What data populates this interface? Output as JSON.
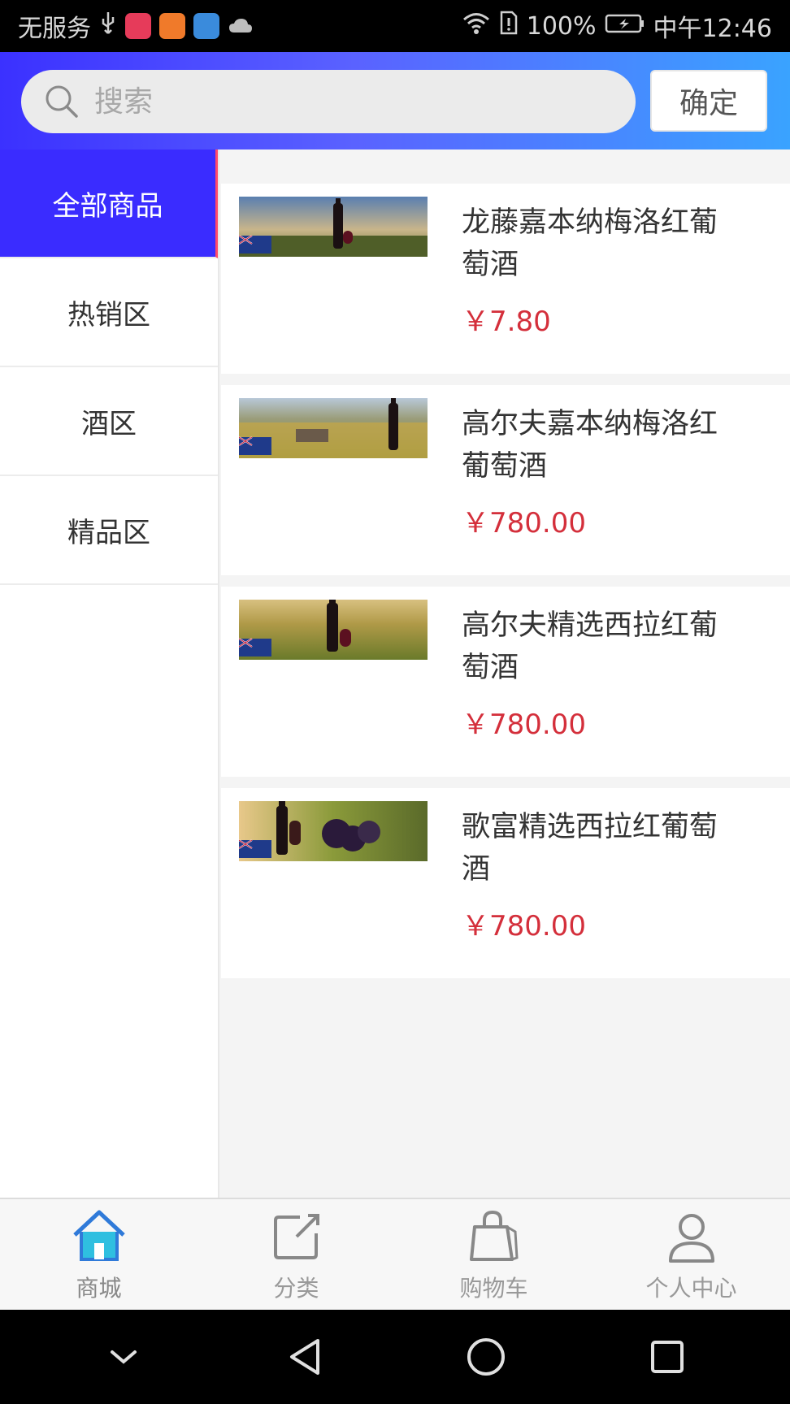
{
  "status_bar": {
    "carrier": "无服务",
    "battery": "100%",
    "time": "中午12:46"
  },
  "search": {
    "placeholder": "搜索",
    "confirm_label": "确定"
  },
  "sidebar": {
    "items": [
      {
        "label": "全部商品",
        "active": true
      },
      {
        "label": "热销区",
        "active": false
      },
      {
        "label": "酒区",
        "active": false
      },
      {
        "label": "精品区",
        "active": false
      }
    ]
  },
  "products": [
    {
      "name": "龙藤嘉本纳梅洛红葡萄酒",
      "price": "￥7.80"
    },
    {
      "name": "高尔夫嘉本纳梅洛红葡萄酒",
      "price": "￥780.00"
    },
    {
      "name": "高尔夫精选西拉红葡萄酒",
      "price": "￥780.00"
    },
    {
      "name": "歌富精选西拉红葡萄酒",
      "price": "￥780.00"
    }
  ],
  "bottom_nav": {
    "items": [
      {
        "label": "商城",
        "icon": "home-icon",
        "active": true
      },
      {
        "label": "分类",
        "icon": "category-icon",
        "active": false
      },
      {
        "label": "购物车",
        "icon": "shopping-bag-icon",
        "active": false
      },
      {
        "label": "个人中心",
        "icon": "user-icon",
        "active": false
      }
    ]
  },
  "colors": {
    "accent": "#3a2cff",
    "price": "#d42f3b",
    "header_gradient_start": "#3b31ff",
    "header_gradient_end": "#3aa3ff"
  }
}
